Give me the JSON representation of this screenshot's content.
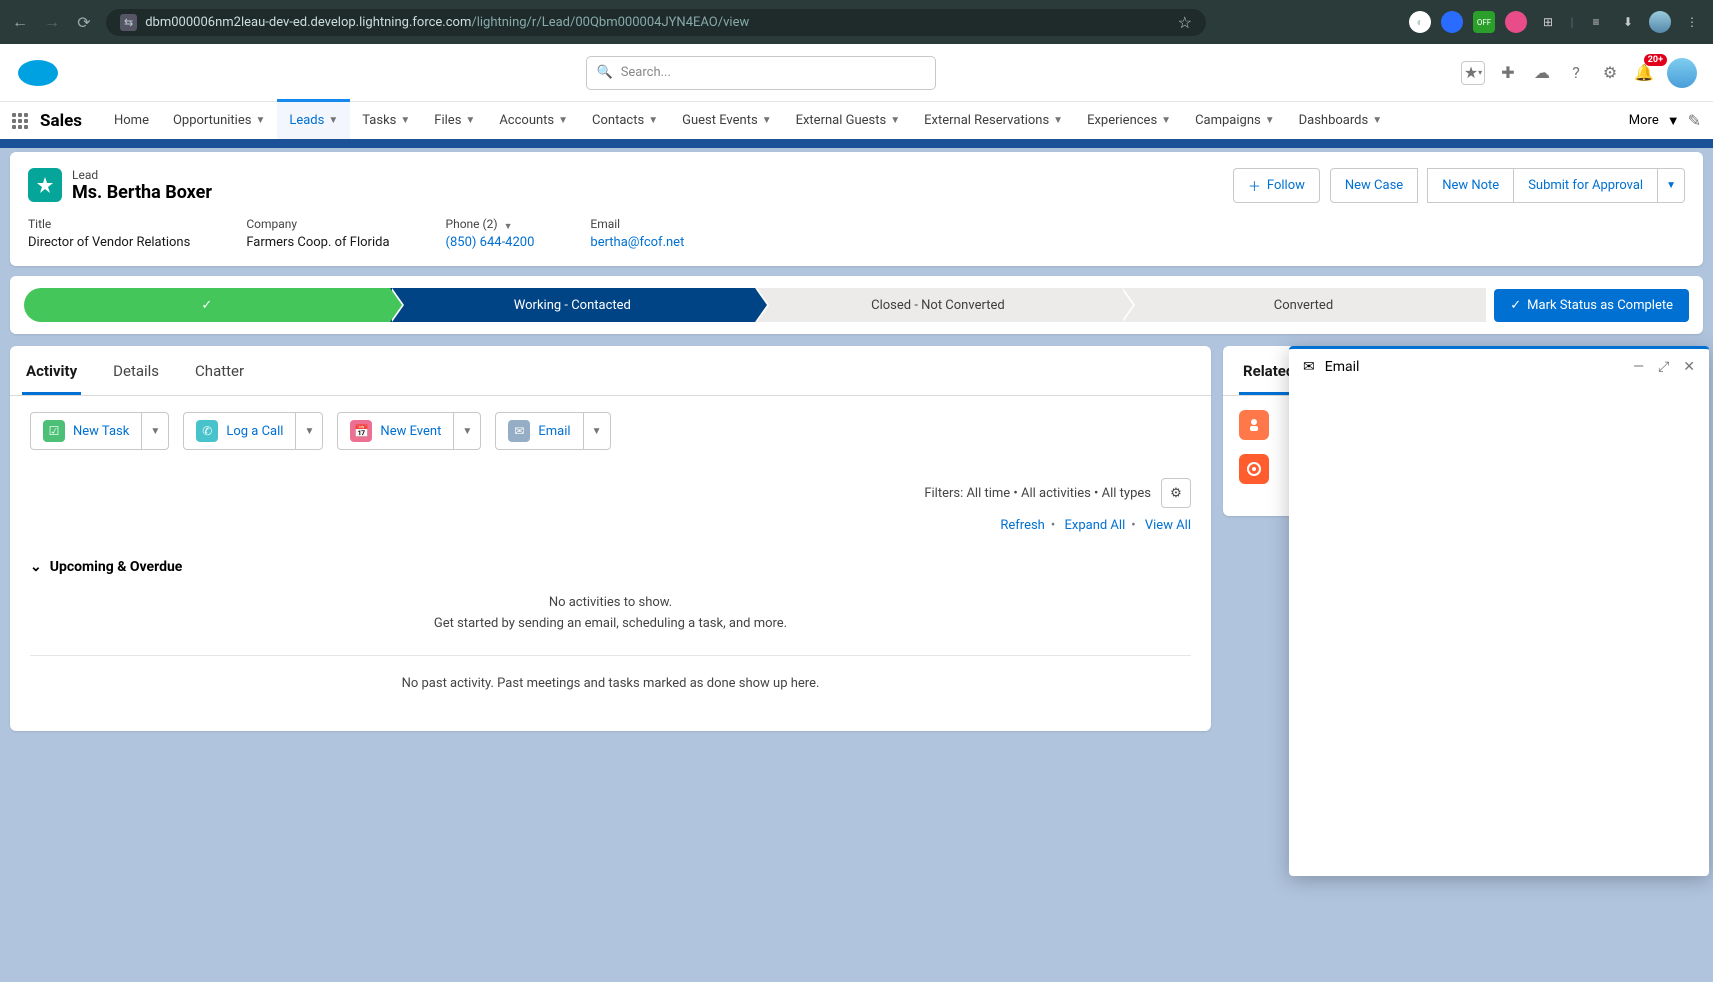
{
  "browser": {
    "url_host": "dbm000006nm2leau-dev-ed.develop.lightning.force.com",
    "url_path": "/lightning/r/Lead/00Qbm000004JYN4EAO/view"
  },
  "search": {
    "placeholder": "Search..."
  },
  "notifications": {
    "count": "20+"
  },
  "app": {
    "name": "Sales"
  },
  "nav": {
    "items": [
      "Home",
      "Opportunities",
      "Leads",
      "Tasks",
      "Files",
      "Accounts",
      "Contacts",
      "Guest Events",
      "External Guests",
      "External Reservations",
      "Experiences",
      "Campaigns",
      "Dashboards"
    ],
    "more": "More"
  },
  "record": {
    "type": "Lead",
    "name": "Ms. Bertha Boxer",
    "actions": {
      "follow": "Follow",
      "newcase": "New Case",
      "newnote": "New Note",
      "submit": "Submit for Approval"
    },
    "fields": {
      "title": {
        "label": "Title",
        "value": "Director of Vendor Relations"
      },
      "company": {
        "label": "Company",
        "value": "Farmers Coop. of Florida"
      },
      "phone": {
        "label": "Phone (2)",
        "value": "(850) 644-4200"
      },
      "email": {
        "label": "Email",
        "value": "bertha@fcof.net"
      }
    }
  },
  "path": {
    "stages": [
      "",
      "Working - Contacted",
      "Closed - Not Converted",
      "Converted"
    ],
    "mark": "Mark Status as Complete"
  },
  "tabs": {
    "activity": "Activity",
    "details": "Details",
    "chatter": "Chatter"
  },
  "quick": {
    "task": "New Task",
    "call": "Log a Call",
    "event": "New Event",
    "email": "Email"
  },
  "filters": {
    "text": "Filters: All time • All activities • All types"
  },
  "links": {
    "refresh": "Refresh",
    "expand": "Expand All",
    "view": "View All"
  },
  "section": {
    "upcoming": "Upcoming & Overdue"
  },
  "empty": {
    "line1": "No activities to show.",
    "line2": "Get started by sending an email, scheduling a task, and more."
  },
  "past": {
    "text": "No past activity. Past meetings and tasks marked as done show up here."
  },
  "related": {
    "tab": "Related"
  },
  "popup": {
    "title": "Email"
  }
}
